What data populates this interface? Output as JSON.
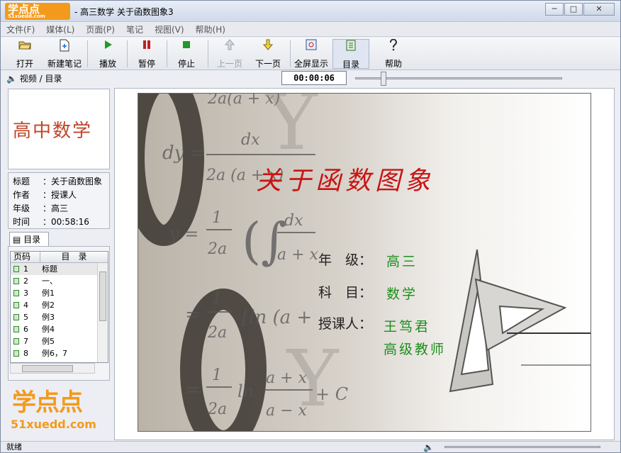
{
  "window": {
    "title": "- 高三数学 关于函数图象3",
    "app_logo": "学点点",
    "app_logo_url": "51xuedd.com",
    "min": "─",
    "max": "□",
    "close": "✕"
  },
  "menu": [
    "文件(F)",
    "媒体(L)",
    "页面(P)",
    "笔记",
    "视图(V)",
    "帮助(H)"
  ],
  "toolbar": {
    "open": "打开",
    "new_note": "新建笔记",
    "play": "播放",
    "pause": "暂停",
    "stop": "停止",
    "prev": "上一页",
    "next": "下一页",
    "fullscreen": "全屏显示",
    "toc": "目录",
    "help": "帮助"
  },
  "left": {
    "header": "视频 / 目录",
    "course_logo": "高中数学",
    "info": [
      {
        "k": "标题",
        "v": "关于函数图象"
      },
      {
        "k": "作者",
        "v": "授课人"
      },
      {
        "k": "年级",
        "v": "高三"
      },
      {
        "k": "时间",
        "v": "00:58:16"
      }
    ],
    "toc_tab": "目录",
    "toc_col_page": "页码",
    "toc_col_title": "目　录",
    "toc": [
      {
        "n": "1",
        "t": "标题"
      },
      {
        "n": "2",
        "t": "一、"
      },
      {
        "n": "3",
        "t": "例1"
      },
      {
        "n": "4",
        "t": "例2"
      },
      {
        "n": "5",
        "t": "例3"
      },
      {
        "n": "6",
        "t": "例4"
      },
      {
        "n": "7",
        "t": "例5"
      },
      {
        "n": "8",
        "t": "例6，7"
      }
    ],
    "brand": "学点点",
    "brand_url": "51xuedd.com"
  },
  "player": {
    "time": "00:00:06",
    "progress": 0.12
  },
  "slide": {
    "title": "关于函数图象",
    "grade_label": "年　级：",
    "grade": "高三",
    "subject_label": "科　目：",
    "subject": "数学",
    "teacher_label": "授课人：",
    "teacher": "王笃君",
    "teacher_title": "高级教师"
  },
  "status": {
    "text": "就绪",
    "volume": 0.0
  },
  "colors": {
    "title_red": "#c81414",
    "value_green": "#1c8f1c",
    "brand_orange": "#f39a1c"
  }
}
